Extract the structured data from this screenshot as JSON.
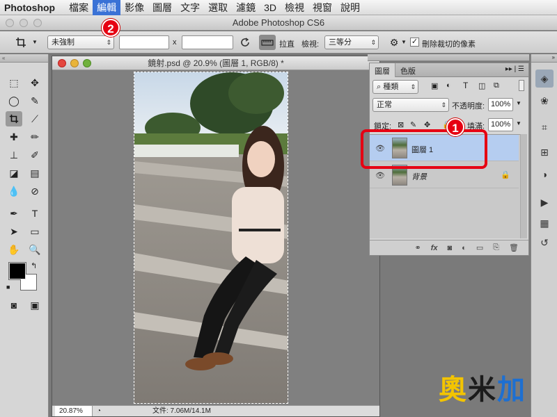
{
  "menubar": {
    "app": "Photoshop",
    "items": [
      "檔案",
      "編輯",
      "影像",
      "圖層",
      "文字",
      "選取",
      "濾鏡",
      "3D",
      "檢視",
      "視窗",
      "說明"
    ],
    "active_index": 1
  },
  "appbar": {
    "title": "Adobe Photoshop CS6"
  },
  "options": {
    "ratio_select": "未強制",
    "x_label": "x",
    "straighten_label": "拉直",
    "view_label": "檢視:",
    "view_select": "三等分",
    "delete_cropped_label": "刪除裁切的像素",
    "delete_cropped_checked": true
  },
  "document": {
    "title": "鏡射.psd @ 20.9% (圖層 1, RGB/8) *",
    "zoom": "20.87%",
    "status": "文件: 7.06M/14.1M"
  },
  "layers_panel": {
    "tabs": [
      "圖層",
      "色版"
    ],
    "filter_select": "種類",
    "blend_mode": "正常",
    "opacity_label": "不透明度:",
    "opacity_value": "100%",
    "lock_label": "鎖定:",
    "fill_label": "填滿:",
    "fill_value": "100%",
    "layers": [
      {
        "name": "圖層 1",
        "selected": true,
        "locked": false
      },
      {
        "name": "背景",
        "selected": false,
        "locked": true
      }
    ]
  },
  "annotations": {
    "badge_one": "1",
    "badge_two": "2"
  },
  "watermark": {
    "a": "奧",
    "b": "米",
    "c": "加"
  },
  "colors": {
    "highlight_red": "#e60012",
    "selected_layer": "#b5cdf0",
    "menu_active": "#3a72d6"
  }
}
